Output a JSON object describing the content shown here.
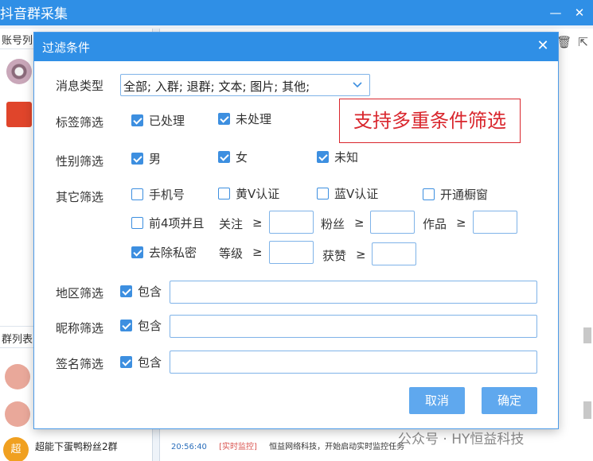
{
  "background": {
    "app_title": "抖音群采集",
    "account_list_label": "账号列",
    "group_list_label": "群列表",
    "group_item_name": "超能下蛋鸭粉丝2群",
    "group_item_badge": "超",
    "log": {
      "time": "20:56:40",
      "tag": "[实时监控]",
      "message": "恒益网络科技，开始启动实时监控任务"
    },
    "watermark": "公众号 · HY恒益科技"
  },
  "dialog": {
    "title": "过滤条件",
    "callout": "支持多重条件筛选",
    "message_type": {
      "label": "消息类型",
      "value": "全部; 入群; 退群; 文本; 图片; 其他;"
    },
    "tag_filter": {
      "label": "标签筛选",
      "options": [
        {
          "label": "已处理",
          "checked": true
        },
        {
          "label": "未处理",
          "checked": true
        }
      ]
    },
    "gender_filter": {
      "label": "性别筛选",
      "options": [
        {
          "label": "男",
          "checked": true
        },
        {
          "label": "女",
          "checked": true
        },
        {
          "label": "未知",
          "checked": true
        }
      ]
    },
    "other_filter": {
      "label": "其它筛选",
      "phone": {
        "label": "手机号",
        "checked": false
      },
      "yellow_v": {
        "label": "黄V认证",
        "checked": false
      },
      "blue_v": {
        "label": "蓝V认证",
        "checked": false
      },
      "showcase": {
        "label": "开通橱窗",
        "checked": false
      },
      "top4": {
        "label": "前4项并且",
        "checked": false
      },
      "follow_label": "关注",
      "fans_label": "粉丝",
      "works_label": "作品",
      "remove_private": {
        "label": "去除私密",
        "checked": true
      },
      "level_label": "等级",
      "likes_label": "获赞",
      "gte": "≥",
      "follow_value": "",
      "fans_value": "",
      "works_value": "",
      "level_value": "",
      "likes_value": ""
    },
    "region_filter": {
      "label": "地区筛选",
      "contains_label": "包含",
      "checked": true,
      "value": ""
    },
    "nickname_filter": {
      "label": "昵称筛选",
      "contains_label": "包含",
      "checked": true,
      "value": ""
    },
    "signature_filter": {
      "label": "签名筛选",
      "contains_label": "包含",
      "checked": true,
      "value": ""
    },
    "buttons": {
      "cancel": "取消",
      "confirm": "确定"
    }
  },
  "colors": {
    "primary": "#2f8fe6",
    "button": "#5fa8ee",
    "callout": "#d9262d",
    "checkbox": "#3d8fe0"
  }
}
